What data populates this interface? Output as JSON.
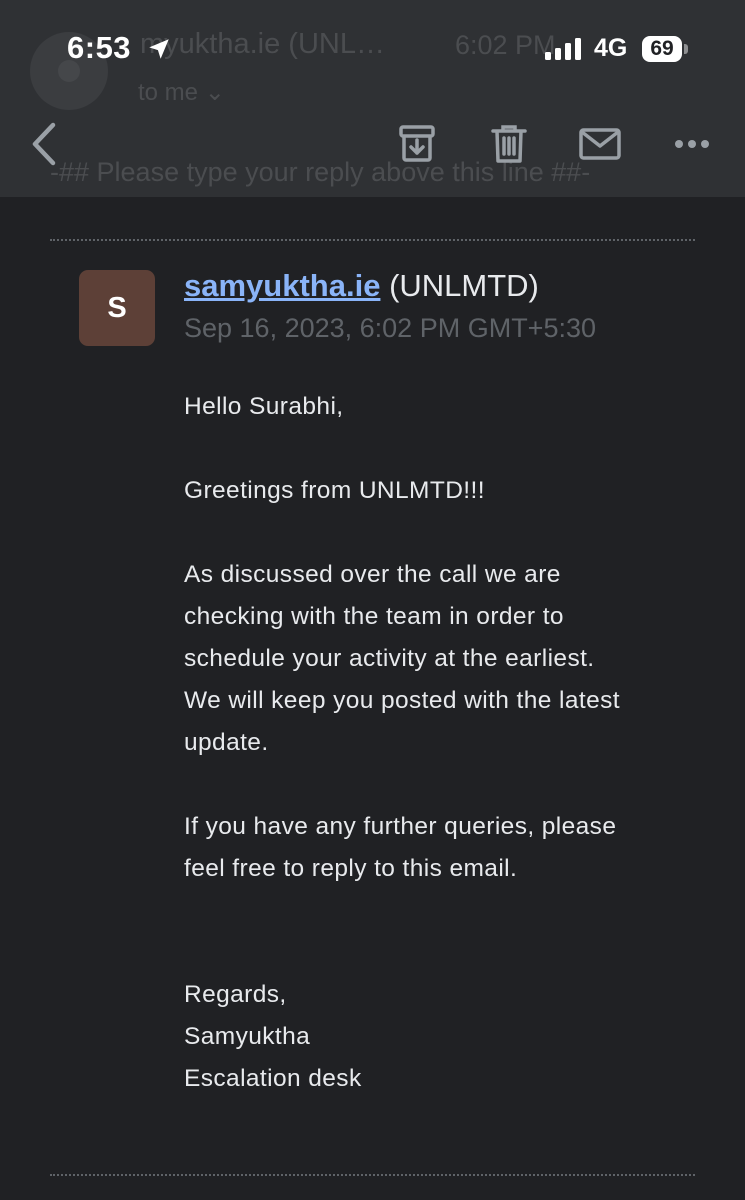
{
  "status_bar": {
    "time": "6:53",
    "network": "4G",
    "battery": "69"
  },
  "background_header": {
    "sender": "myuktha.ie (UNL…",
    "time": "6:02 PM",
    "to": "to me ⌄",
    "reply_hint": "-## Please type your reply above this line ##-"
  },
  "toolbar": {
    "back_icon": "chevron-left-icon",
    "archive_icon": "archive-icon",
    "delete_icon": "trash-icon",
    "mail_icon": "mail-icon",
    "more_icon": "more-horizontal-icon"
  },
  "message": {
    "avatar_letter": "S",
    "avatar_color": "#5d4037",
    "sender_name": "samyuktha.ie",
    "sender_org": "(UNLMTD)",
    "date": "Sep 16, 2023, 6:02 PM GMT+5:30",
    "greeting": "Hello Surabhi,",
    "intro": "Greetings from UNLMTD!!!",
    "para1_lines": [
      "As discussed over the call we are",
      "checking with the team in order to",
      "schedule your activity at the earliest.",
      "We will keep you posted with the latest",
      "update."
    ],
    "para2_lines": [
      "If you have any further queries, please",
      "feel free to reply to this email."
    ],
    "signoff": "Regards,",
    "signature_name": "Samyuktha",
    "signature_title": "Escalation desk"
  },
  "colors": {
    "background": "#202124",
    "link": "#8ab4f8",
    "muted": "#5f6368"
  }
}
